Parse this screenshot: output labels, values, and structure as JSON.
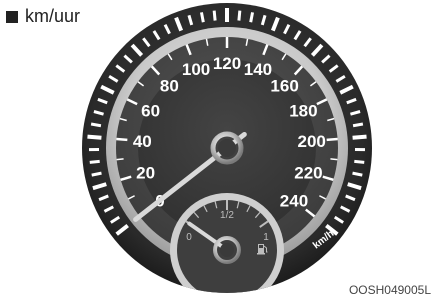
{
  "unit_label": "km/uur",
  "image_code": "OOSH049005L",
  "speedometer": {
    "min": 0,
    "max": 240,
    "current_speed": 0,
    "tick_labels": [
      "0",
      "20",
      "40",
      "60",
      "80",
      "100",
      "120",
      "140",
      "160",
      "180",
      "200",
      "220",
      "240"
    ],
    "unit_text": "km/h"
  },
  "fuel_gauge": {
    "labels": [
      "0",
      "1/2",
      "1"
    ],
    "level": 0,
    "icon": "fuel-pump-icon"
  },
  "colors": {
    "bezel": "#2a2a2a",
    "dial": "#d2d2d2",
    "face": "#474747",
    "inner_face": "#3a3a3a",
    "text": "#ffffff",
    "needle": "#d9d9d9"
  }
}
